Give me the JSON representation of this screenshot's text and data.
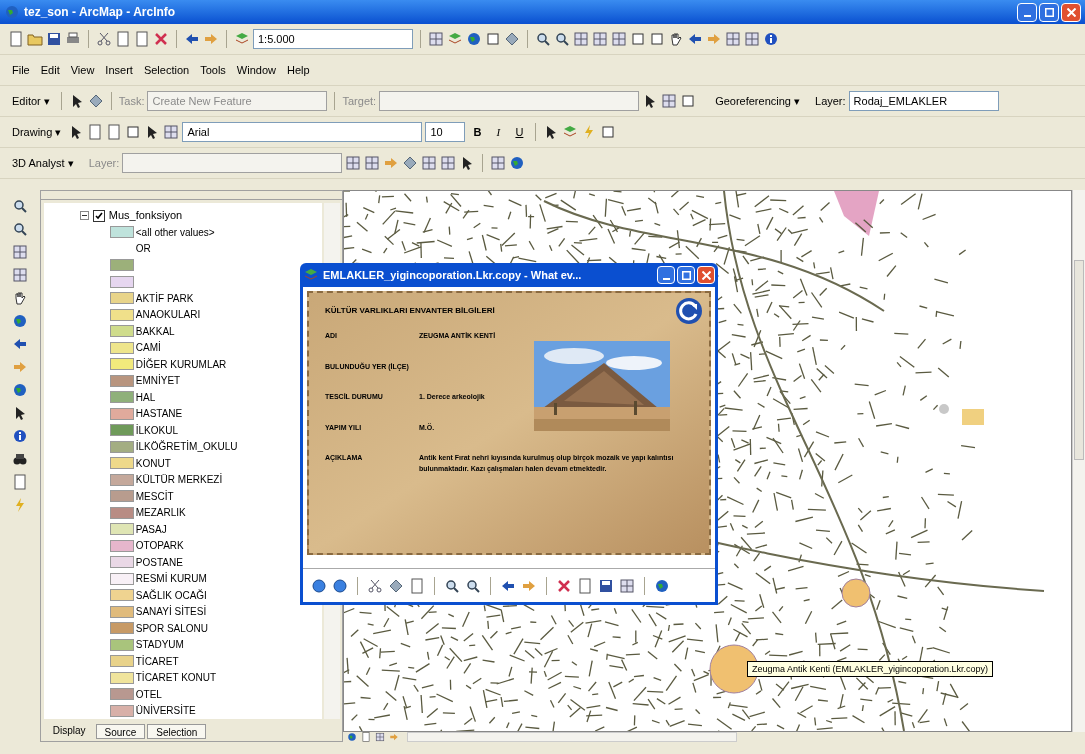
{
  "window": {
    "title": "tez_son - ArcMap - ArcInfo"
  },
  "standard_toolbar": {
    "scale": "1:5.000"
  },
  "menu": [
    "File",
    "Edit",
    "View",
    "Insert",
    "Selection",
    "Tools",
    "Window",
    "Help"
  ],
  "editor_toolbar": {
    "editor": "Editor ▾",
    "task_label": "Task:",
    "task": "Create New Feature",
    "target_label": "Target:",
    "georeferencing": "Georeferencing ▾",
    "layer_label": "Layer:",
    "layer": "Rodaj_EMLAKLER"
  },
  "drawing_toolbar": {
    "drawing": "Drawing ▾",
    "font": "Arial",
    "size": "10",
    "bold": "B",
    "italic": "I",
    "underline": "U"
  },
  "analyst_toolbar": {
    "menu": "3D Analyst ▾",
    "layer_label": "Layer:"
  },
  "toc": {
    "layer": {
      "name": "Mus_fonksiyon",
      "expanded": true,
      "visible": true
    },
    "legend": [
      {
        "kind": "class",
        "label": "<all other values>",
        "color": "#bfe3dc"
      },
      {
        "kind": "heading",
        "label": "OR"
      },
      {
        "kind": "class",
        "color": "#9cb07a"
      },
      {
        "kind": "class",
        "color": "#e6d6f0"
      },
      {
        "kind": "class",
        "label": "AKTİF PARK",
        "color": "#e8d48a"
      },
      {
        "kind": "class",
        "label": "ANAOKULARI",
        "color": "#f0e08a"
      },
      {
        "kind": "class",
        "label": "BAKKAL",
        "color": "#cfdc8c"
      },
      {
        "kind": "class",
        "label": "CAMİ",
        "color": "#eee58c"
      },
      {
        "kind": "class",
        "label": "DİĞER KURUMLAR",
        "color": "#f2ea7c"
      },
      {
        "kind": "class",
        "label": "EMNİYET",
        "color": "#b8957f"
      },
      {
        "kind": "class",
        "label": "HAL",
        "color": "#8fb07a"
      },
      {
        "kind": "class",
        "label": "HASTANE",
        "color": "#e0aa9c"
      },
      {
        "kind": "class",
        "label": "İLKOKUL",
        "color": "#6f9a5a"
      },
      {
        "kind": "class",
        "label": "İLKÖĞRETİM_OKULU",
        "color": "#a3ad82"
      },
      {
        "kind": "class",
        "label": "KONUT",
        "color": "#eed98a"
      },
      {
        "kind": "class",
        "label": "KÜLTÜR MERKEZİ",
        "color": "#c4a89b"
      },
      {
        "kind": "class",
        "label": "MESCİT",
        "color": "#b89c8e"
      },
      {
        "kind": "class",
        "label": "MEZARLIK",
        "color": "#b88c84"
      },
      {
        "kind": "class",
        "label": "PASAJ",
        "color": "#dfe5b4"
      },
      {
        "kind": "class",
        "label": "OTOPARK",
        "color": "#e6b6cc"
      },
      {
        "kind": "class",
        "label": "POSTANE",
        "color": "#ead8e6"
      },
      {
        "kind": "class",
        "label": "RESMİ KURUM",
        "color": "#f8f0f6"
      },
      {
        "kind": "class",
        "label": "SAĞLIK OCAĞI",
        "color": "#efd390"
      },
      {
        "kind": "class",
        "label": "SANAYİ SİTESİ",
        "color": "#e0bb7c"
      },
      {
        "kind": "class",
        "label": "SPOR SALONU",
        "color": "#c79a66"
      },
      {
        "kind": "class",
        "label": "STADYUM",
        "color": "#a9c47c"
      },
      {
        "kind": "class",
        "label": "TİCARET",
        "color": "#e8d28a"
      },
      {
        "kind": "class",
        "label": "TİCARET KONUT",
        "color": "#f0e49c"
      },
      {
        "kind": "class",
        "label": "OTEL",
        "color": "#b89890"
      },
      {
        "kind": "class",
        "label": "ÜNİVERSİTE",
        "color": "#d8b0a8"
      }
    ]
  },
  "toc_tabs": [
    {
      "label": "Display",
      "selected": true
    },
    {
      "label": "Source",
      "selected": false
    },
    {
      "label": "Selection",
      "selected": false
    }
  ],
  "popup": {
    "title": "EMLAKLER_yigincoporation.Lkr.copy - What ev...",
    "heading": "KÜLTÜR VARLIKLARI ENVANTER BİLGİLERİ",
    "rows": [
      {
        "label": "ADI",
        "value": "ZEUGMA ANTİK KENTİ"
      },
      {
        "label": "BULUNDUĞU YER (İLÇE)",
        "value": ""
      },
      {
        "label": "TESCİL DURUMU",
        "value": "1. Derece arkeolojik"
      },
      {
        "label": "YAPIM YILI",
        "value": "M.Ö."
      },
      {
        "label": "AÇIKLAMA",
        "value": "Antik kent Fırat nehri kıyısında kurulmuş olup birçok mozaik ve yapı kalıntısı bulunmaktadır. Kazı çalışmaları halen devam etmektedir."
      }
    ]
  },
  "tooltip": "Zeugma Antik Kenti (EMLAKLER_yigincoporation.Lkr.copy)"
}
